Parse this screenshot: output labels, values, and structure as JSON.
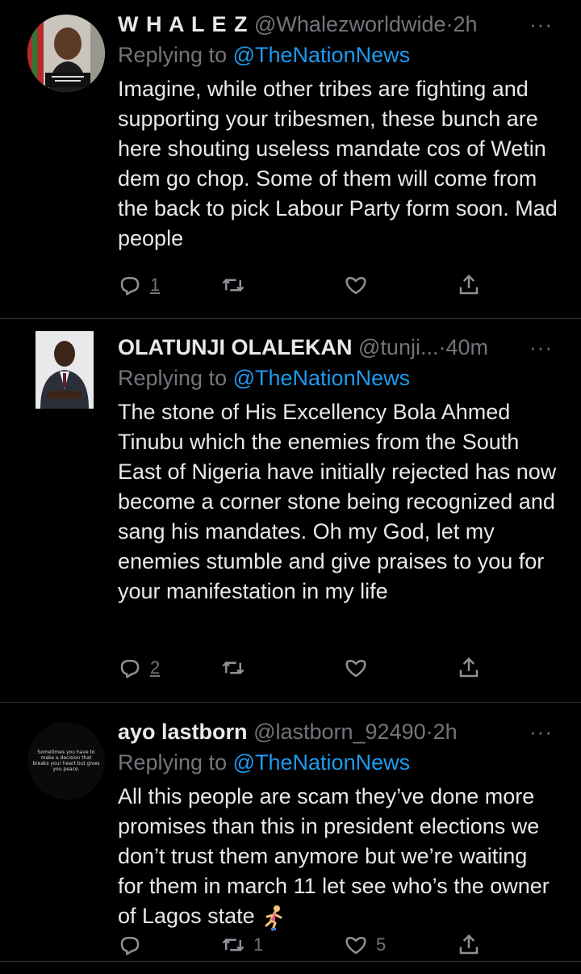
{
  "tweets": [
    {
      "name": "W H A L E Z",
      "handle": "@Whalezworldwide",
      "time": "2h",
      "replying_prefix": "Replying to",
      "replying_to": "@TheNationNews",
      "text": "Imagine, while other tribes are fighting and supporting your tribesmen, these bunch are here shouting useless mandate cos of Wetin dem go chop. Some of them will come from the back to pick Labour Party form soon. Mad people",
      "reply_count": "1",
      "retweet_count": "",
      "like_count": ""
    },
    {
      "name": "OLATUNJI OLALEKAN",
      "handle": "@tunji...",
      "time": "40m",
      "replying_prefix": "Replying to",
      "replying_to": "@TheNationNews",
      "text": "The stone of His Excellency Bola Ahmed Tinubu which the enemies from the South East of Nigeria have initially rejected has now become a corner stone being recognized and sang his mandates. Oh my God, let my enemies stumble and give praises to you for your manifestation in my life",
      "reply_count": "2",
      "retweet_count": "",
      "like_count": ""
    },
    {
      "name": "ayo lastborn",
      "handle": "@lastborn_92490",
      "time": "2h",
      "replying_prefix": "Replying to",
      "replying_to": "@TheNationNews",
      "text": "All this people are scam they’ve done more promises than this in president elections we don’t trust them anymore but we’re waiting for them in march 11 let see who’s the owner of Lagos state",
      "avatar_text": "Sometimes you have to make a decision that breaks your heart but gives you peace.",
      "reply_count": "",
      "retweet_count": "1",
      "like_count": "5"
    }
  ],
  "separator": "·",
  "more_glyph": "···",
  "icons": [
    "reply-icon",
    "retweet-icon",
    "like-icon",
    "share-icon",
    "more-icon",
    "runner-emoji-icon"
  ],
  "colors": {
    "background": "#000000",
    "text": "#e7e9ea",
    "muted": "#71767b",
    "link": "#1d9bf0",
    "divider": "#2f3336"
  }
}
